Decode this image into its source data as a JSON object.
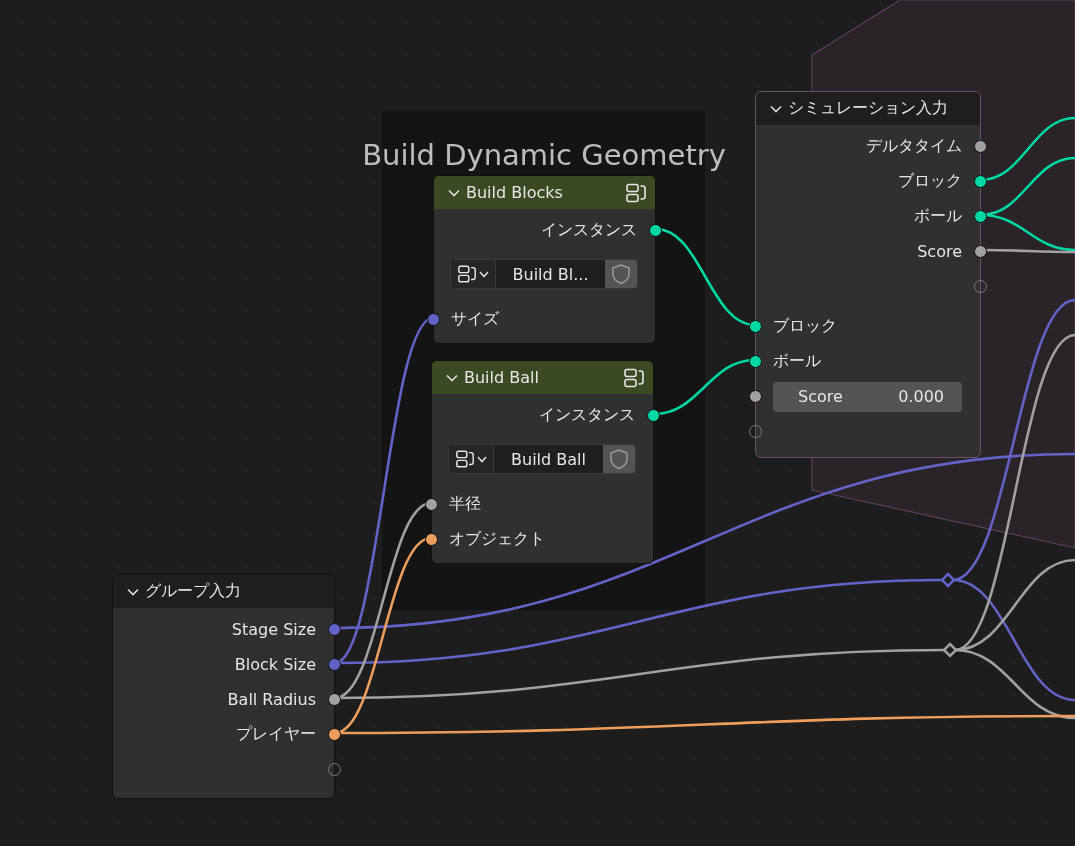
{
  "frame": {
    "label": "Build Dynamic Geometry"
  },
  "nodes": [
    {
      "kind": "group",
      "title": "Build Blocks",
      "outputs": [
        {
          "kind": "socket",
          "label": "インスタンス",
          "color": "#00d6a3"
        }
      ],
      "datablock": "Build Bl...",
      "inputs": [
        {
          "kind": "socket",
          "label": "サイズ",
          "color": "#6363c7"
        }
      ]
    },
    {
      "kind": "group",
      "title": "Build Ball",
      "outputs": [
        {
          "kind": "socket",
          "label": "インスタンス",
          "color": "#00d6a3"
        }
      ],
      "datablock": "Build Ball",
      "inputs": [
        {
          "kind": "socket",
          "label": "半径",
          "color": "#a1a1a1"
        },
        {
          "kind": "socket",
          "label": "オブジェクト",
          "color": "#ed9e5c"
        }
      ]
    },
    {
      "kind": "plain",
      "title": "シミュレーション入力",
      "outputs": [
        {
          "kind": "socket",
          "label": "デルタタイム",
          "color": "#a1a1a1"
        },
        {
          "kind": "socket",
          "label": "ブロック",
          "color": "#00d6a3"
        },
        {
          "kind": "socket",
          "label": "ボール",
          "color": "#00d6a3"
        },
        {
          "kind": "socket",
          "label": "Score",
          "color": "#a1a1a1"
        },
        {
          "kind": "virtual"
        }
      ],
      "inputs": [
        {
          "kind": "socket",
          "label": "ブロック",
          "color": "#00d6a3"
        },
        {
          "kind": "socket",
          "label": "ボール",
          "color": "#00d6a3"
        },
        {
          "kind": "field",
          "label": "Score",
          "value": "0.000",
          "color": "#a1a1a1"
        },
        {
          "kind": "virtual"
        }
      ]
    },
    {
      "kind": "plain",
      "title": "グループ入力",
      "outputs": [
        {
          "kind": "socket",
          "label": "Stage Size",
          "color": "#6363c7"
        },
        {
          "kind": "socket",
          "label": "Block Size",
          "color": "#6363c7"
        },
        {
          "kind": "socket",
          "label": "Ball Radius",
          "color": "#a1a1a1"
        },
        {
          "kind": "socket",
          "label": "プレイヤー",
          "color": "#ed9e5c"
        },
        {
          "kind": "virtual"
        }
      ]
    }
  ]
}
